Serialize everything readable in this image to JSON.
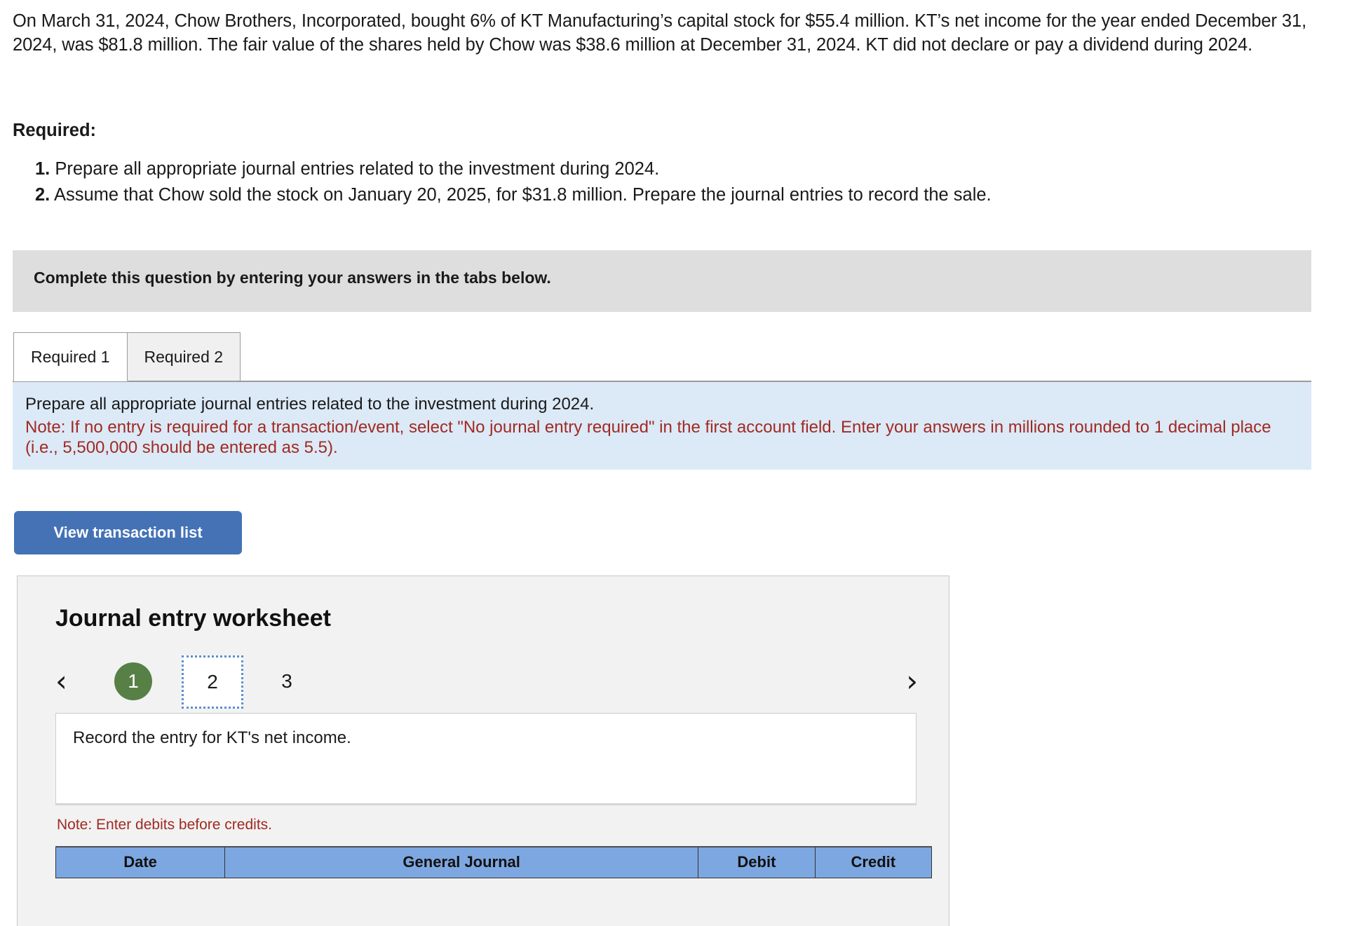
{
  "problem": {
    "statement": "On March 31, 2024, Chow Brothers, Incorporated, bought 6% of KT Manufacturing’s capital stock for $55.4 million. KT’s net income for the year ended December 31, 2024, was $81.8 million. The fair value of the shares held by Chow was $38.6 million at December 31, 2024. KT did not declare or pay a dividend during 2024.",
    "required_label": "Required:",
    "requirements": [
      {
        "num": "1.",
        "text": "Prepare all appropriate journal entries related to the investment during 2024."
      },
      {
        "num": "2.",
        "text": "Assume that Chow sold the stock on January 20, 2025, for $31.8 million. Prepare the journal entries to record the sale."
      }
    ]
  },
  "banner": {
    "text": "Complete this question by entering your answers in the tabs below."
  },
  "tabs": [
    {
      "label": "Required 1",
      "active": true
    },
    {
      "label": "Required 2",
      "active": false
    }
  ],
  "note_panel": {
    "instruction": "Prepare all appropriate journal entries related to the investment during 2024.",
    "note": "Note: If no entry is required for a transaction/event, select \"No journal entry required\" in the first account field. Enter your answers in millions rounded to 1 decimal place (i.e., 5,500,000 should be entered as 5.5)."
  },
  "toolbar": {
    "view_transaction_list_label": "View transaction list"
  },
  "worksheet": {
    "title": "Journal entry worksheet",
    "pagination": {
      "prev_icon": "‹",
      "next_icon": "›",
      "pages": [
        {
          "label": "1",
          "state": "completed"
        },
        {
          "label": "2",
          "state": "current"
        },
        {
          "label": "3",
          "state": "pending"
        }
      ]
    },
    "description": "Record the entry for KT's net income.",
    "debits_note": "Note: Enter debits before credits.",
    "table": {
      "columns": [
        "Date",
        "General Journal",
        "Debit",
        "Credit"
      ],
      "rows": []
    }
  },
  "colors": {
    "accent_blue": "#4472b5",
    "table_header_blue": "#7da7e0",
    "info_panel_blue": "#dce9f7",
    "banner_grey": "#dedede",
    "completed_green": "#578046",
    "note_red": "#a02a22"
  }
}
